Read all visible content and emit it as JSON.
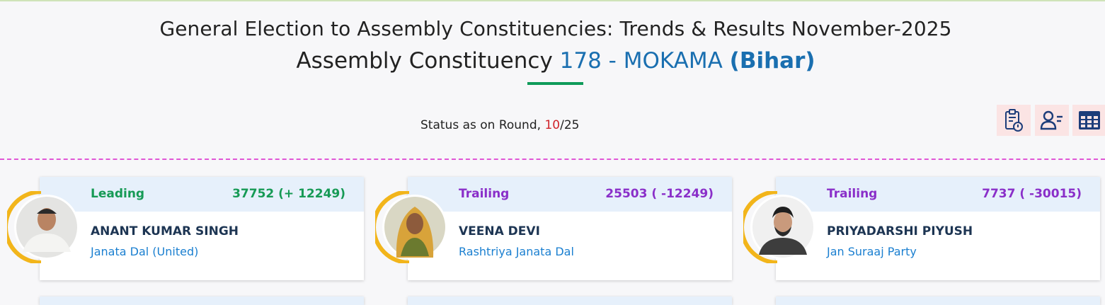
{
  "header": {
    "title": "General Election to Assembly Constituencies: Trends & Results November-2025",
    "subtitle_prefix": "Assembly Constituency",
    "constituency": "178 - MOKAMA",
    "state": "(Bihar)"
  },
  "status": {
    "label": "Status as on Round,",
    "current_round": "10",
    "separator": "/",
    "total_rounds": "25"
  },
  "toolbar": {
    "icons": [
      "clipboard-report-icon",
      "candidate-list-icon",
      "table-grid-icon"
    ]
  },
  "colors": {
    "leading": "#169a55",
    "trailing": "#8a2fc9",
    "card_header_bg": "#e6f0fb",
    "party": "#1a7fd0",
    "accent_ring": "#f2b51b"
  },
  "candidates": [
    {
      "status": "Leading",
      "votes": "37752 (+ 12249)",
      "name": "ANANT KUMAR SINGH",
      "party": "Janata Dal (United)"
    },
    {
      "status": "Trailing",
      "votes": "25503 ( -12249)",
      "name": "VEENA DEVI",
      "party": "Rashtriya Janata Dal"
    },
    {
      "status": "Trailing",
      "votes": "7737 ( -30015)",
      "name": "PRIYADARSHI PIYUSH",
      "party": "Jan Suraaj Party"
    }
  ]
}
